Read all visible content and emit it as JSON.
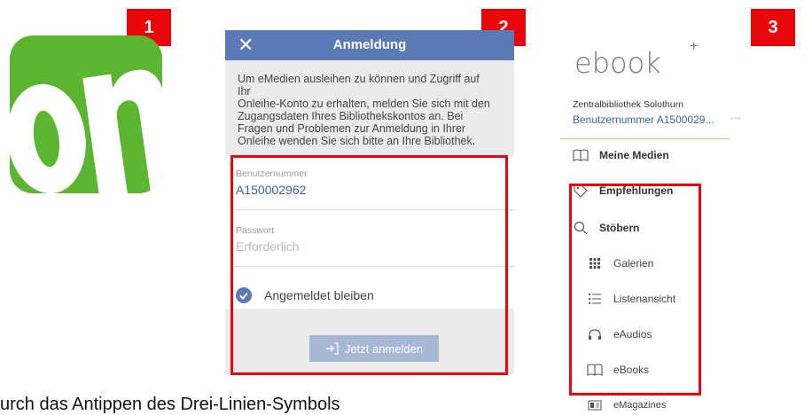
{
  "badges": [
    "1",
    "2",
    "3"
  ],
  "app_icon": {
    "name": "onleihe-app-icon",
    "color": "#5cb531"
  },
  "login": {
    "title": "Anmeldung",
    "close_glyph": "✕",
    "intro_lines": [
      "Um eMedien ausleihen zu können und Zugriff auf Ihr",
      "Onleihe-Konto zu erhalten, melden Sie sich mit den",
      "Zugangsdaten Ihres Bibliothekskontos an. Bei",
      "Fragen und Problemen zur Anmeldung in Ihrer",
      "Onleihe wenden Sie sich bitte an Ihre Bibliothek."
    ],
    "user_label": "Benutzernummer",
    "user_value": "A150002962",
    "password_label": "Passwort",
    "password_placeholder": "Erforderlich",
    "stay_logged_in": "Angemeldet bleiben",
    "submit": "Jetzt anmelden",
    "accent": "#5b7ab5"
  },
  "menu": {
    "logo_text": "ebook",
    "logo_plus": "+",
    "library": "Zentralbibliothek Solothurn",
    "user": "Benutzernummer A1500029...",
    "more": "◦◦◦",
    "items": {
      "meine_medien": "Meine Medien",
      "empfehlungen": "Empfehlungen",
      "stoebern": "Stöbern",
      "galerien": "Galerien",
      "listenansicht": "Listenansicht",
      "eaudios": "eAudios",
      "ebooks": "eBooks",
      "emagazines": "eMagazines"
    }
  },
  "caption": "urch das Antippen des Drei-Linien-Symbols",
  "highlight_color": "#e8050c"
}
